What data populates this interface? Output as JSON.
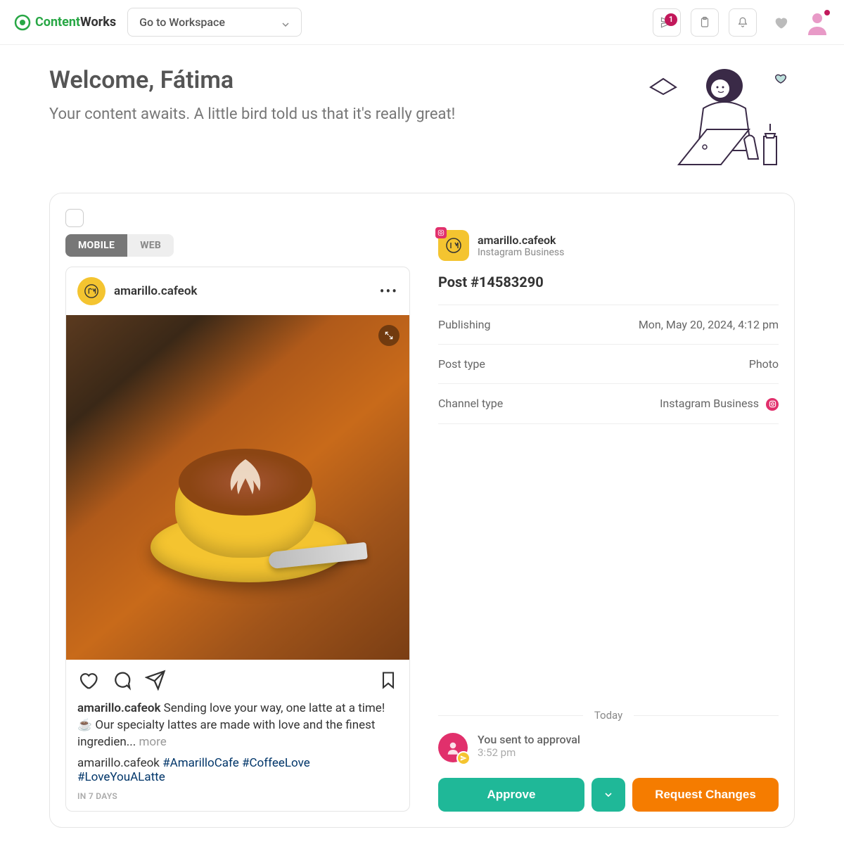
{
  "topbar": {
    "logo_a": "Content",
    "logo_b": "Works",
    "workspace_label": "Go to Workspace",
    "badge": "1"
  },
  "welcome": {
    "heading": "Welcome, Fátima",
    "subtitle": "Your content awaits. A little bird told us that it's really great!"
  },
  "preview": {
    "tabs": {
      "mobile": "MOBILE",
      "web": "WEB"
    },
    "account": "amarillo.cafeok",
    "caption_user": "amarillo.cafeok",
    "caption_text": " Sending love your way, one latte at a time! ☕ Our specialty lattes are made with love and the finest ingredien... ",
    "more": "more",
    "hashtags_user": "amarillo.cafeok ",
    "hashtag1": "#AmarilloCafe",
    "hashtag2": "#CoffeeLove",
    "hashtag3": "#LoveYouALatte",
    "time_label": "IN 7 DAYS"
  },
  "details": {
    "account_name": "amarillo.cafeok",
    "account_type": "Instagram Business",
    "post_id": "Post #14583290",
    "publishing_label": "Publishing",
    "publishing_value": "Mon, May 20, 2024, 4:12 pm",
    "posttype_label": "Post type",
    "posttype_value": "Photo",
    "channeltype_label": "Channel type",
    "channeltype_value": "Instagram Business"
  },
  "activity": {
    "today": "Today",
    "sent_text": "You sent to approval",
    "sent_time": "3:52 pm"
  },
  "actions": {
    "approve": "Approve",
    "request": "Request Changes"
  }
}
